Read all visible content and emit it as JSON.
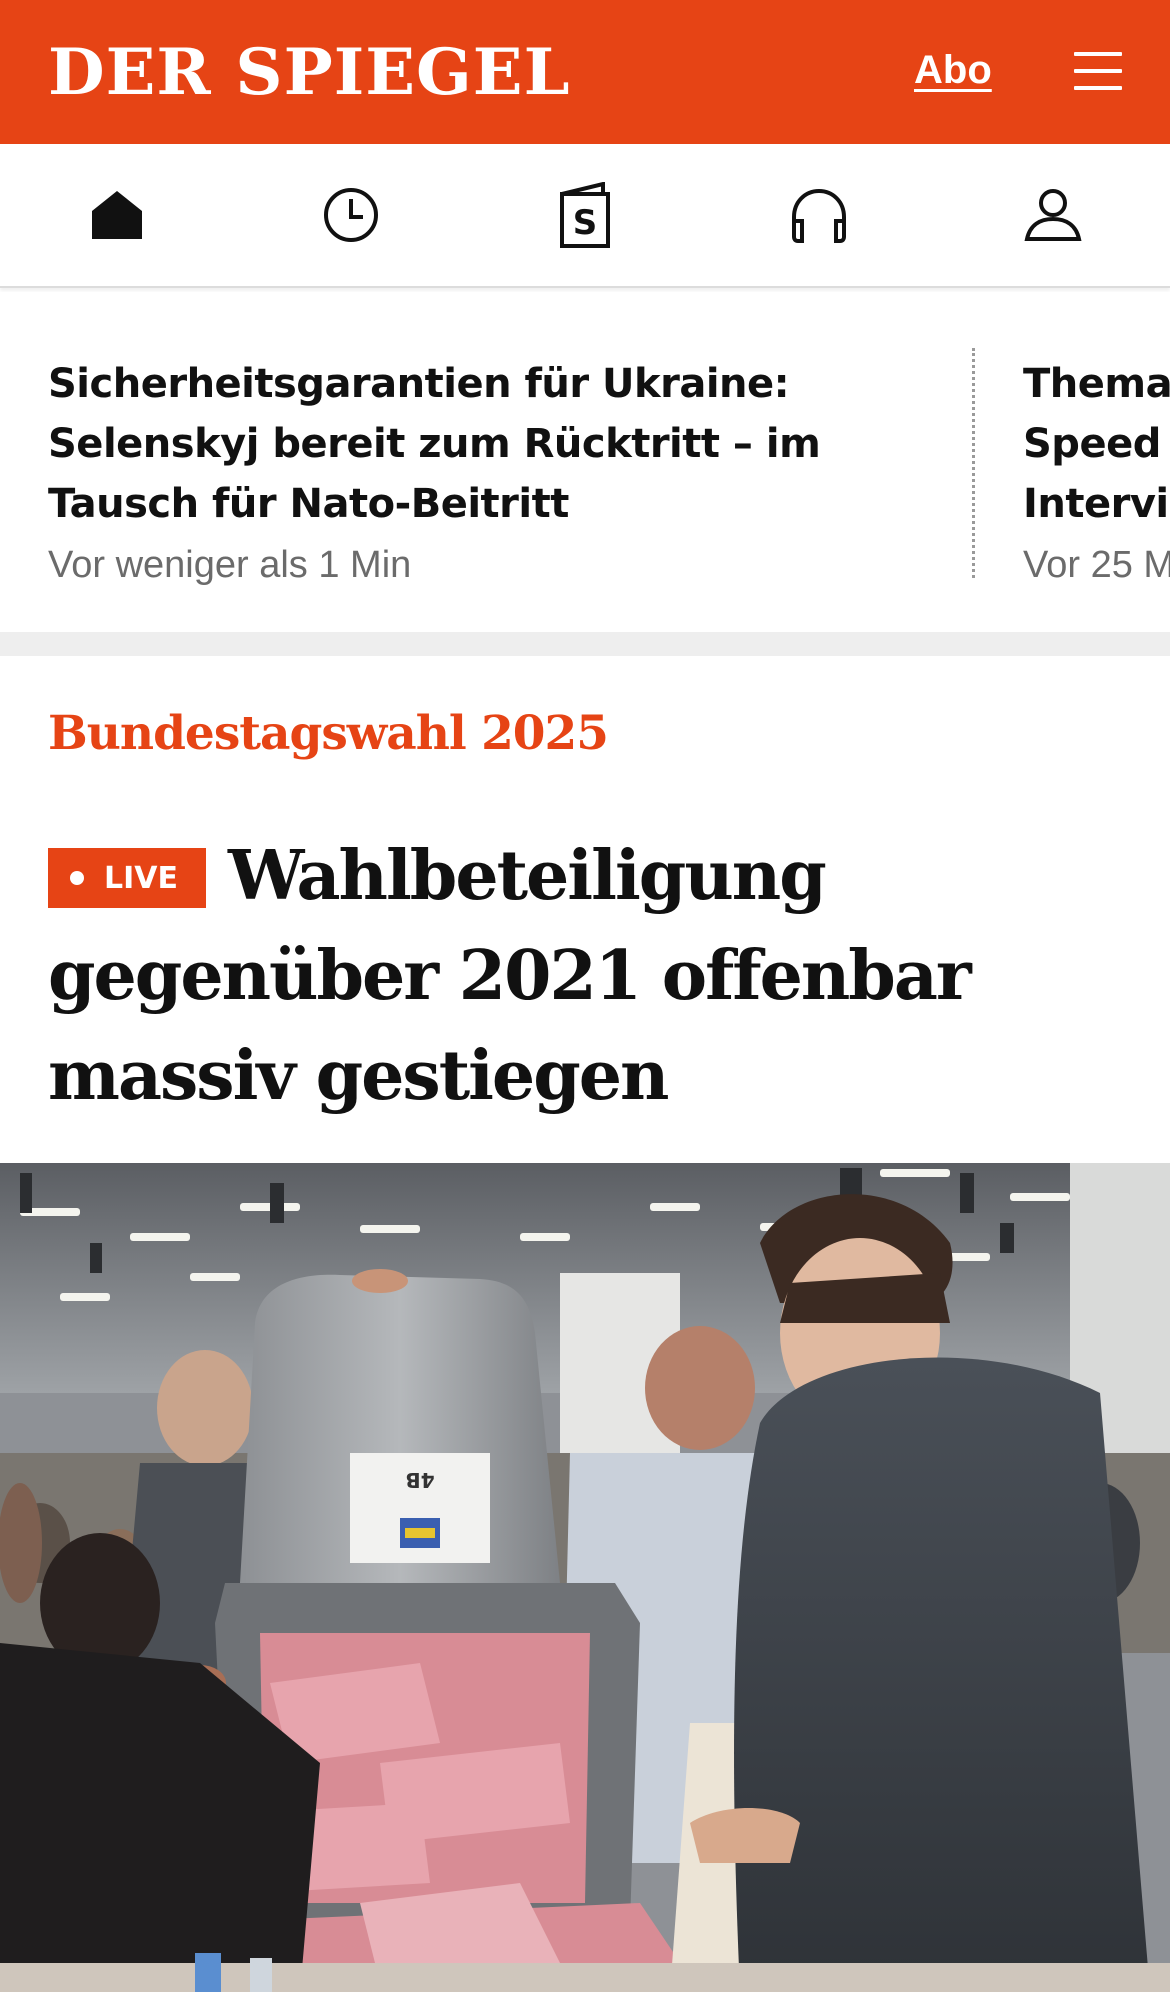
{
  "header": {
    "logo": "DER SPIEGEL",
    "abo_label": "Abo",
    "menu_icon": "hamburger-menu-icon",
    "brand_color": "#e64415"
  },
  "icon_nav": [
    {
      "icon": "home-icon",
      "active": true
    },
    {
      "icon": "clock-icon"
    },
    {
      "icon": "spiegel-magazine-icon",
      "glyph": "S"
    },
    {
      "icon": "headphones-icon"
    },
    {
      "icon": "user-icon"
    }
  ],
  "ticker": {
    "items": [
      {
        "title": "Sicherheitsgarantien für Ukraine: Selenskyj bereit zum Rücktritt – im Tausch für Nato-Beitritt",
        "time": "Vor weniger als 1 Min"
      },
      {
        "title_lines": [
          "Thema",
          "Speed",
          "Intervi"
        ],
        "time": "Vor 25 M"
      }
    ]
  },
  "article": {
    "kicker": "Bundestagswahl 2025",
    "live_label": "LIVE",
    "headline": "Wahlbeteiligung gegenüber 2021 offenbar massiv gestiegen",
    "ballot_label": "4B"
  }
}
